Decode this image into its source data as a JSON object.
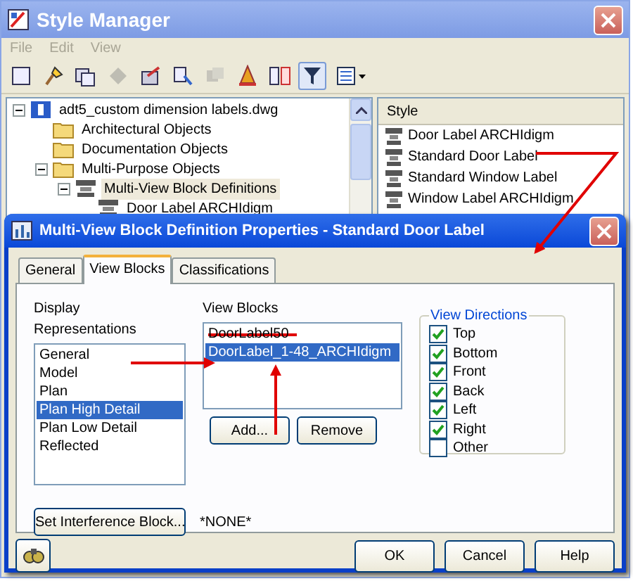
{
  "style_manager": {
    "title": "Style Manager",
    "menu": [
      {
        "label": "File",
        "disabled": true
      },
      {
        "label": "Edit",
        "disabled": true
      },
      {
        "label": "View",
        "disabled": true
      }
    ],
    "toolbar": [
      {
        "kind": "new",
        "pressed": false,
        "disabled": false
      },
      {
        "kind": "purge",
        "pressed": false,
        "disabled": false
      },
      {
        "kind": "copy",
        "pressed": false,
        "disabled": false
      },
      {
        "kind": "paste",
        "pressed": false,
        "disabled": true
      },
      {
        "kind": "edit",
        "pressed": false,
        "disabled": false
      },
      {
        "kind": "select",
        "pressed": false,
        "disabled": false
      },
      {
        "kind": "sync",
        "pressed": false,
        "disabled": true
      },
      {
        "kind": "paint",
        "pressed": false,
        "disabled": false
      },
      {
        "kind": "compare",
        "pressed": false,
        "disabled": false
      },
      {
        "kind": "filter",
        "pressed": true,
        "disabled": false
      },
      {
        "kind": "view",
        "pressed": false,
        "disabled": false
      }
    ],
    "tree": [
      {
        "label": "adt5_custom dimension labels.dwg",
        "kind": "drawing",
        "expanded": true,
        "selected": false,
        "children": [
          {
            "label": "Architectural Objects",
            "kind": "folder",
            "selected": false
          },
          {
            "label": "Documentation Objects",
            "kind": "folder",
            "selected": false
          },
          {
            "label": "Multi-Purpose Objects",
            "kind": "folder",
            "expanded": true,
            "selected": false,
            "children": [
              {
                "label": "Multi-View Block Definitions",
                "kind": "block",
                "expanded": true,
                "selected": true,
                "children": [
                  {
                    "label": "Door Label ARCHIdigm",
                    "kind": "style",
                    "selected": false
                  }
                ]
              }
            ]
          }
        ]
      }
    ],
    "style_list": {
      "header": "Style",
      "items": [
        "Door Label ARCHIdigm",
        "Standard Door Label",
        "Standard Window Label",
        "Window Label ARCHIdigm"
      ]
    }
  },
  "dialog": {
    "title": "Multi-View Block Definition Properties - Standard Door Label",
    "tabs": [
      {
        "label": "General",
        "selected": false
      },
      {
        "label": "View Blocks",
        "selected": true
      },
      {
        "label": "Classifications",
        "selected": false
      }
    ],
    "display_representations": {
      "label": "Display Representations",
      "items": [
        {
          "label": "General",
          "selected": false
        },
        {
          "label": "Model",
          "selected": false
        },
        {
          "label": "Plan",
          "selected": false
        },
        {
          "label": "Plan High Detail",
          "selected": true
        },
        {
          "label": "Plan Low Detail",
          "selected": false
        },
        {
          "label": "Reflected",
          "selected": false
        }
      ]
    },
    "view_blocks": {
      "label": "View Blocks",
      "items": [
        {
          "label": "DoorLabel50",
          "selected": false,
          "struck": true
        },
        {
          "label": "DoorLabel_1-48_ARCHIdigm",
          "selected": true,
          "struck": false
        }
      ],
      "buttons": [
        "Add...",
        "Remove"
      ]
    },
    "view_directions": {
      "label": "View Directions",
      "items": [
        {
          "label": "Top",
          "checked": true
        },
        {
          "label": "Bottom",
          "checked": true
        },
        {
          "label": "Front",
          "checked": true
        },
        {
          "label": "Back",
          "checked": true
        },
        {
          "label": "Left",
          "checked": true
        },
        {
          "label": "Right",
          "checked": true
        },
        {
          "label": "Other",
          "checked": false
        }
      ]
    },
    "interference": {
      "button": "Set Interference Block...",
      "value": "*NONE*"
    },
    "buttons": [
      "OK",
      "Cancel",
      "Help"
    ]
  }
}
